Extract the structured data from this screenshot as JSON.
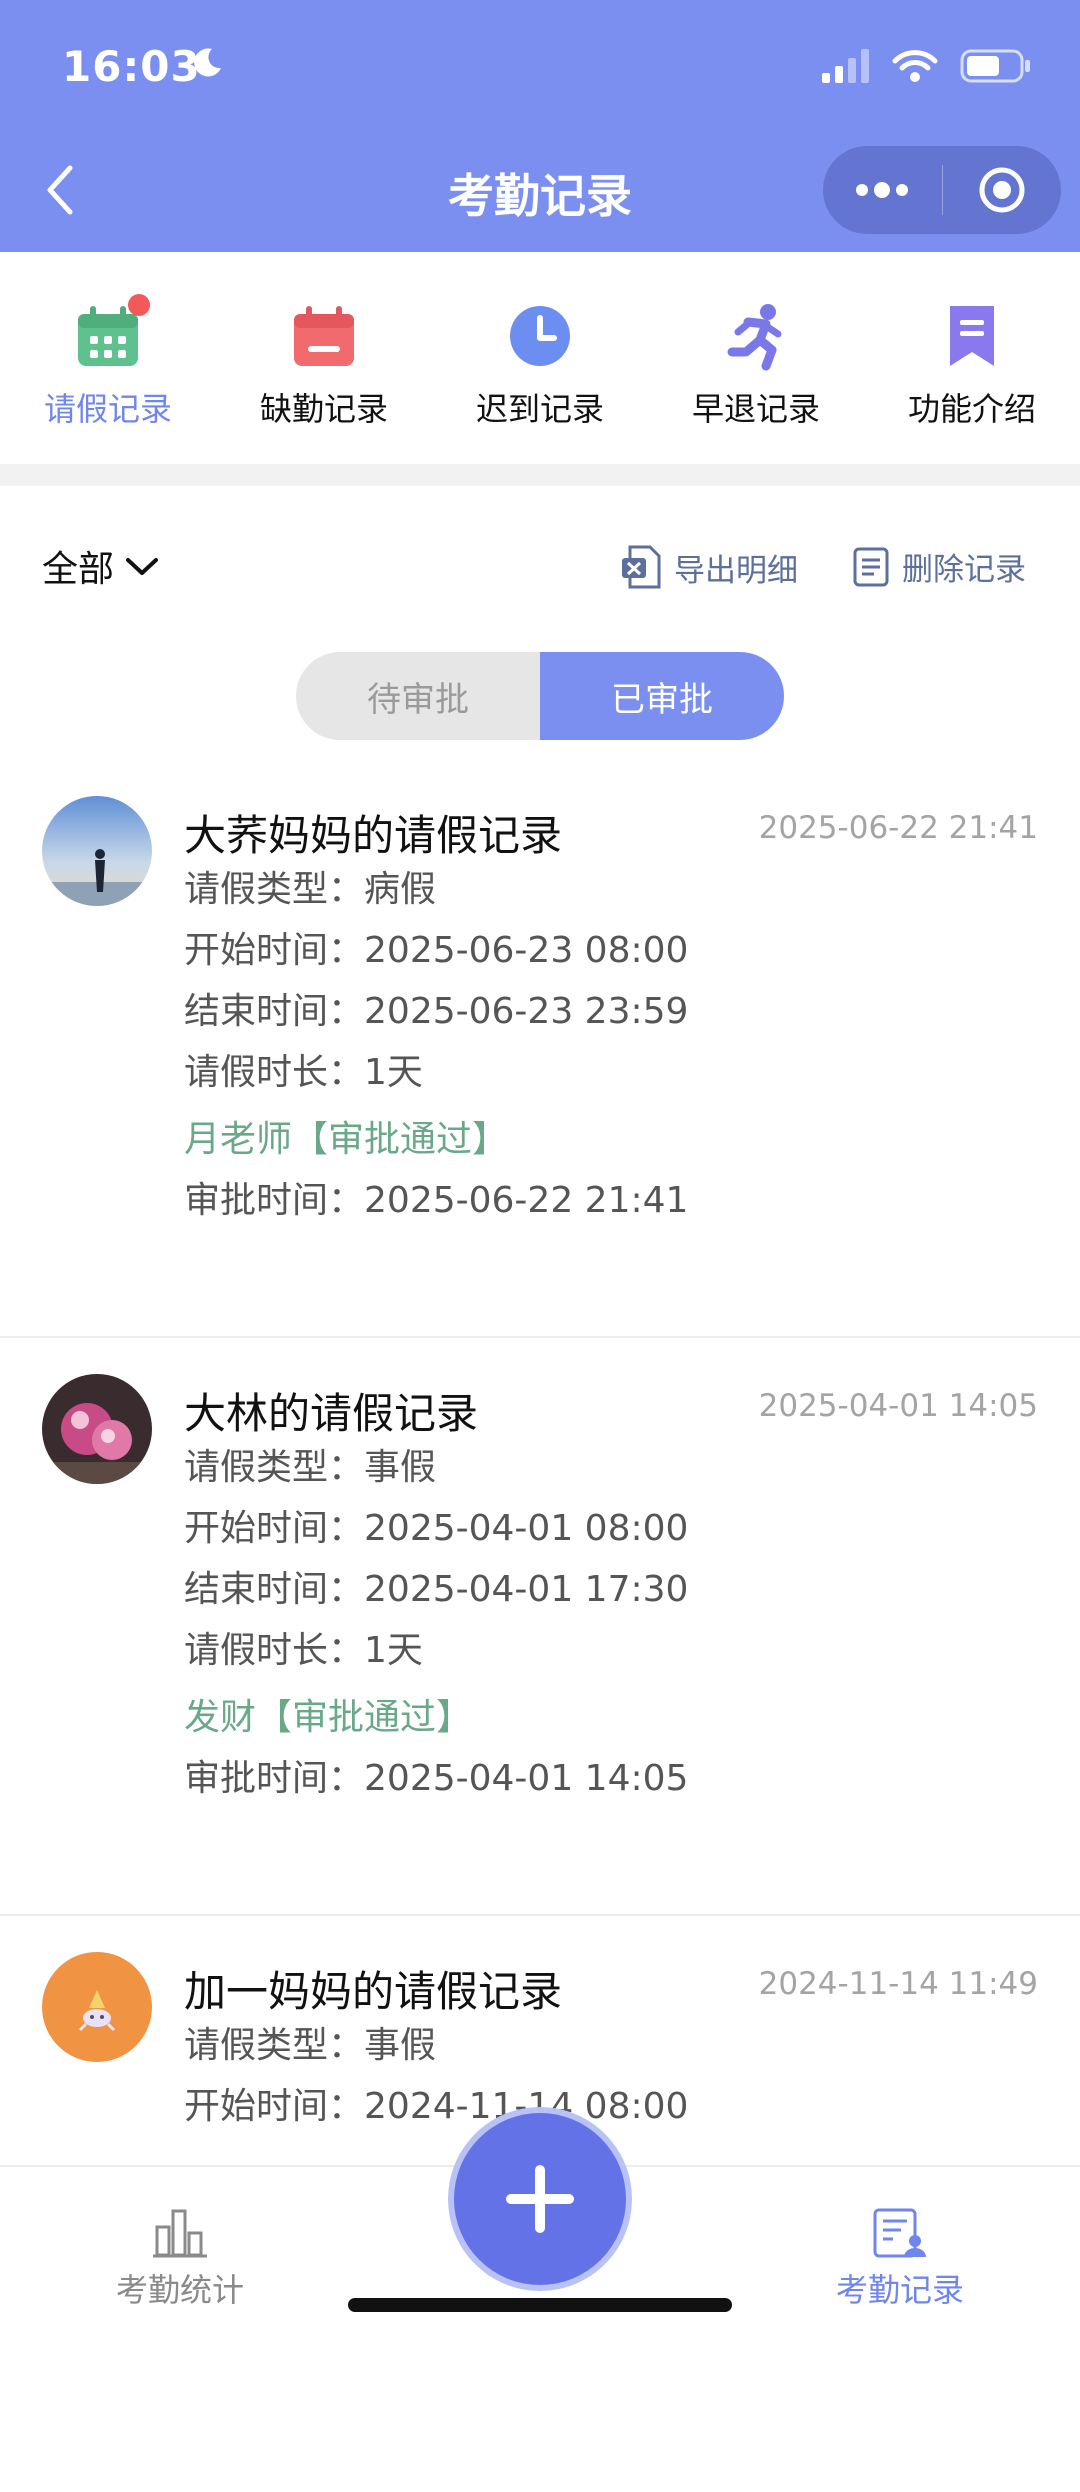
{
  "status_bar": {
    "time": "16:03"
  },
  "header": {
    "title": "考勤记录"
  },
  "nav": {
    "items": [
      {
        "label": "请假记录",
        "active": true
      },
      {
        "label": "缺勤记录"
      },
      {
        "label": "迟到记录"
      },
      {
        "label": "早退记录"
      },
      {
        "label": "功能介绍"
      }
    ]
  },
  "toolbar": {
    "filter_label": "全部",
    "export_label": "导出明细",
    "delete_label": "删除记录"
  },
  "segment": {
    "pending": "待审批",
    "approved": "已审批",
    "selected": "approved"
  },
  "records": [
    {
      "title": "大荞妈妈的请假记录",
      "created": "2025-06-22 21:41",
      "type_label": "请假类型：",
      "type": "病假",
      "start_label": "开始时间：",
      "start": "2025-06-23 08:00",
      "end_label": "结束时间：",
      "end": "2025-06-23 23:59",
      "duration_label": "请假时长：",
      "duration": "1天",
      "approver": "月老师【审批通过】",
      "approved_label": "审批时间：",
      "approved_at": "2025-06-22 21:41"
    },
    {
      "title": "大林的请假记录",
      "created": "2025-04-01 14:05",
      "type_label": "请假类型：",
      "type": "事假",
      "start_label": "开始时间：",
      "start": "2025-04-01 08:00",
      "end_label": "结束时间：",
      "end": "2025-04-01 17:30",
      "duration_label": "请假时长：",
      "duration": "1天",
      "approver": "发财【审批通过】",
      "approved_label": "审批时间：",
      "approved_at": "2025-04-01 14:05"
    },
    {
      "title": "加一妈妈的请假记录",
      "created": "2024-11-14 11:49",
      "type_label": "请假类型：",
      "type": "事假",
      "start_label": "开始时间：",
      "start": "2024-11-14 08:00"
    }
  ],
  "tabbar": {
    "left_label": "考勤统计",
    "right_label": "考勤记录"
  },
  "colors": {
    "accent": "#7b8ff0",
    "approved_text": "#6aa88a",
    "fab": "#6372e6"
  }
}
